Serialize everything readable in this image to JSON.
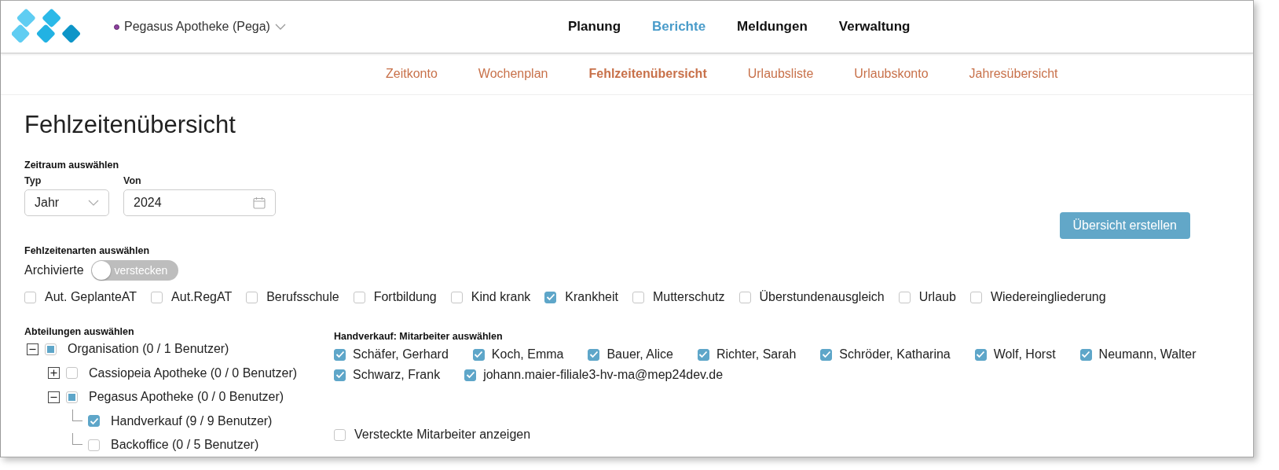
{
  "header": {
    "store": {
      "name": "Pegasus Apotheke (Pega)",
      "color": "#8e3fa0"
    },
    "nav": [
      {
        "label": "Planung",
        "selected": false
      },
      {
        "label": "Berichte",
        "selected": true
      },
      {
        "label": "Meldungen",
        "selected": false
      },
      {
        "label": "Verwaltung",
        "selected": false
      }
    ]
  },
  "subnav": [
    {
      "label": "Zeitkonto",
      "selected": false
    },
    {
      "label": "Wochenplan",
      "selected": false
    },
    {
      "label": "Fehlzeitenübersicht",
      "selected": true
    },
    {
      "label": "Urlaubsliste",
      "selected": false
    },
    {
      "label": "Urlaubskonto",
      "selected": false
    },
    {
      "label": "Jahresübersicht",
      "selected": false
    }
  ],
  "page_title": "Fehlzeitenübersicht",
  "period": {
    "heading": "Zeitraum auswählen",
    "type_label": "Typ",
    "type_value": "Jahr",
    "from_label": "Von",
    "from_value": "2024"
  },
  "create_button": "Übersicht erstellen",
  "absence_types": {
    "heading": "Fehlzeitenarten auswählen",
    "archived_label": "Archivierte",
    "archived_toggle": {
      "text": "verstecken",
      "on": false
    },
    "items": [
      {
        "label": "Aut. GeplanteAT",
        "checked": false
      },
      {
        "label": "Aut.RegAT",
        "checked": false
      },
      {
        "label": "Berufsschule",
        "checked": false
      },
      {
        "label": "Fortbildung",
        "checked": false
      },
      {
        "label": "Kind krank",
        "checked": false
      },
      {
        "label": "Krankheit",
        "checked": true
      },
      {
        "label": "Mutterschutz",
        "checked": false
      },
      {
        "label": "Überstundenausgleich",
        "checked": false
      },
      {
        "label": "Urlaub",
        "checked": false
      },
      {
        "label": "Wiedereingliederung",
        "checked": false
      }
    ]
  },
  "departments": {
    "heading": "Abteilungen auswählen",
    "tree": [
      {
        "label": "Organisation (0 / 1 Benutzer)",
        "expanded": true,
        "checked": false,
        "partial": true,
        "children": [
          {
            "label": "Cassiopeia Apotheke (0 / 0 Benutzer)",
            "expanded": false,
            "checked": false,
            "partial": false
          },
          {
            "label": "Pegasus Apotheke (0 / 0 Benutzer)",
            "expanded": true,
            "checked": false,
            "partial": true,
            "children": [
              {
                "label": "Handverkauf (9 / 9 Benutzer)",
                "checked": true
              },
              {
                "label": "Backoffice (0 / 5 Benutzer)",
                "checked": false
              }
            ]
          }
        ]
      }
    ]
  },
  "employees": {
    "heading": "Handverkauf: Mitarbeiter auswählen",
    "items": [
      {
        "label": "Schäfer, Gerhard",
        "checked": true
      },
      {
        "label": "Koch, Emma",
        "checked": true
      },
      {
        "label": "Bauer, Alice",
        "checked": true
      },
      {
        "label": "Richter, Sarah",
        "checked": true
      },
      {
        "label": "Schröder, Katharina",
        "checked": true
      },
      {
        "label": "Wolf, Horst",
        "checked": true
      },
      {
        "label": "Neumann, Walter",
        "checked": true
      },
      {
        "label": "Schwarz, Frank",
        "checked": true
      },
      {
        "label": "johann.maier-filiale3-hv-ma@mep24dev.de",
        "checked": true
      }
    ],
    "show_hidden": {
      "label": "Versteckte Mitarbeiter anzeigen",
      "checked": false
    }
  }
}
